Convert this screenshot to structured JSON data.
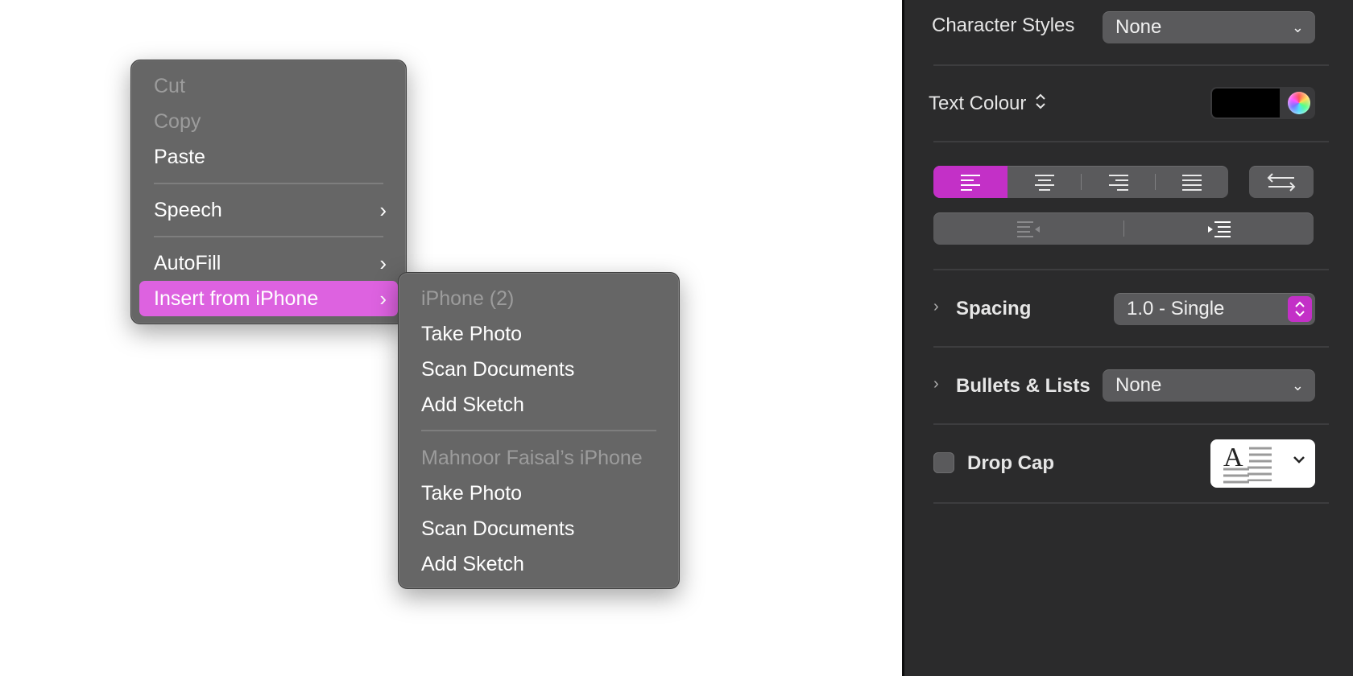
{
  "context_menu": {
    "items": [
      {
        "label": "Cut",
        "enabled": false
      },
      {
        "label": "Copy",
        "enabled": false
      },
      {
        "label": "Paste",
        "enabled": true
      },
      {
        "label": "Speech",
        "enabled": true,
        "has_submenu": true
      },
      {
        "label": "AutoFill",
        "enabled": true,
        "has_submenu": true
      },
      {
        "label": "Insert from iPhone",
        "enabled": true,
        "has_submenu": true,
        "highlighted": true
      }
    ],
    "chevron": "›"
  },
  "submenu": {
    "groups": [
      {
        "header": "iPhone (2)",
        "items": [
          "Take Photo",
          "Scan Documents",
          "Add Sketch"
        ]
      },
      {
        "header": "Mahnoor Faisal’s iPhone",
        "items": [
          "Take Photo",
          "Scan Documents",
          "Add Sketch"
        ]
      }
    ]
  },
  "inspector": {
    "character_styles": {
      "label": "Character Styles",
      "value": "None"
    },
    "text_colour": {
      "label": "Text Colour",
      "color": "#000000"
    },
    "alignment": {
      "selected": "left",
      "options": [
        "left",
        "center",
        "right",
        "justify"
      ]
    },
    "spacing": {
      "label": "Spacing",
      "value": "1.0 - Single"
    },
    "bullets": {
      "label": "Bullets & Lists",
      "value": "None"
    },
    "drop_cap": {
      "label": "Drop Cap",
      "checked": false,
      "preview_letter": "A"
    }
  },
  "colors": {
    "accent": "#c330c7",
    "menu_highlight": "#dd62e0",
    "menu_bg": "#666666",
    "panel_bg": "#2b2b2c"
  }
}
